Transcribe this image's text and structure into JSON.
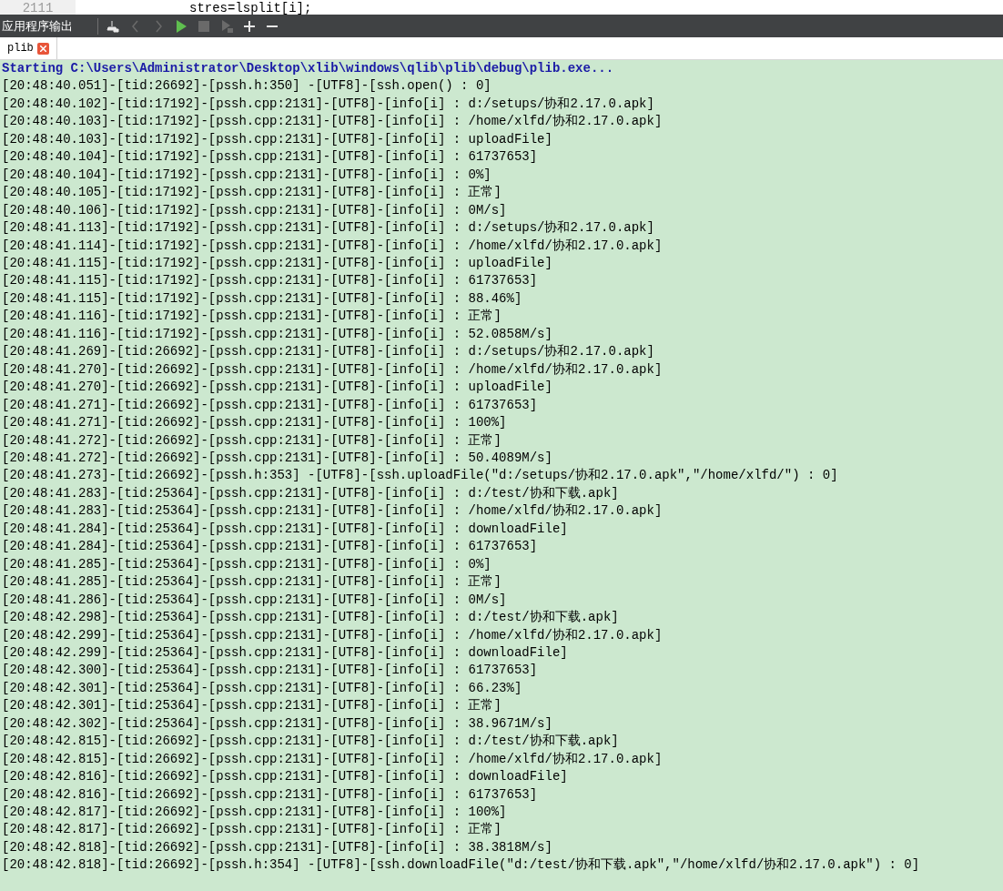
{
  "editor_line": {
    "number": "2111",
    "code": "stres=lsplit[i];"
  },
  "panel": {
    "title": "应用程序输出",
    "toolbar": [
      {
        "kind": "clear",
        "disabled": false
      },
      {
        "kind": "prev",
        "disabled": true
      },
      {
        "kind": "next",
        "disabled": true
      },
      {
        "kind": "run",
        "disabled": false
      },
      {
        "kind": "stop",
        "disabled": true
      },
      {
        "kind": "debug",
        "disabled": true
      },
      {
        "kind": "zoom_in",
        "disabled": false
      },
      {
        "kind": "zoom_out",
        "disabled": false
      }
    ]
  },
  "tabs": [
    {
      "label": "plib",
      "selected": true
    }
  ],
  "output": {
    "header": "Starting C:\\Users\\Administrator\\Desktop\\xlib\\windows\\qlib\\plib\\debug\\plib.exe...",
    "lines": [
      "[20:48:40.051]-[tid:26692]-[pssh.h:350] -[UTF8]-[ssh.open() : 0]",
      "[20:48:40.102]-[tid:17192]-[pssh.cpp:2131]-[UTF8]-[info[i] : d:/setups/协和2.17.0.apk]",
      "[20:48:40.103]-[tid:17192]-[pssh.cpp:2131]-[UTF8]-[info[i] : /home/xlfd/协和2.17.0.apk]",
      "[20:48:40.103]-[tid:17192]-[pssh.cpp:2131]-[UTF8]-[info[i] : uploadFile]",
      "[20:48:40.104]-[tid:17192]-[pssh.cpp:2131]-[UTF8]-[info[i] : 61737653]",
      "[20:48:40.104]-[tid:17192]-[pssh.cpp:2131]-[UTF8]-[info[i] : 0%]",
      "[20:48:40.105]-[tid:17192]-[pssh.cpp:2131]-[UTF8]-[info[i] : 正常]",
      "[20:48:40.106]-[tid:17192]-[pssh.cpp:2131]-[UTF8]-[info[i] : 0M/s]",
      "[20:48:41.113]-[tid:17192]-[pssh.cpp:2131]-[UTF8]-[info[i] : d:/setups/协和2.17.0.apk]",
      "[20:48:41.114]-[tid:17192]-[pssh.cpp:2131]-[UTF8]-[info[i] : /home/xlfd/协和2.17.0.apk]",
      "[20:48:41.115]-[tid:17192]-[pssh.cpp:2131]-[UTF8]-[info[i] : uploadFile]",
      "[20:48:41.115]-[tid:17192]-[pssh.cpp:2131]-[UTF8]-[info[i] : 61737653]",
      "[20:48:41.115]-[tid:17192]-[pssh.cpp:2131]-[UTF8]-[info[i] : 88.46%]",
      "[20:48:41.116]-[tid:17192]-[pssh.cpp:2131]-[UTF8]-[info[i] : 正常]",
      "[20:48:41.116]-[tid:17192]-[pssh.cpp:2131]-[UTF8]-[info[i] : 52.0858M/s]",
      "[20:48:41.269]-[tid:26692]-[pssh.cpp:2131]-[UTF8]-[info[i] : d:/setups/协和2.17.0.apk]",
      "[20:48:41.270]-[tid:26692]-[pssh.cpp:2131]-[UTF8]-[info[i] : /home/xlfd/协和2.17.0.apk]",
      "[20:48:41.270]-[tid:26692]-[pssh.cpp:2131]-[UTF8]-[info[i] : uploadFile]",
      "[20:48:41.271]-[tid:26692]-[pssh.cpp:2131]-[UTF8]-[info[i] : 61737653]",
      "[20:48:41.271]-[tid:26692]-[pssh.cpp:2131]-[UTF8]-[info[i] : 100%]",
      "[20:48:41.272]-[tid:26692]-[pssh.cpp:2131]-[UTF8]-[info[i] : 正常]",
      "[20:48:41.272]-[tid:26692]-[pssh.cpp:2131]-[UTF8]-[info[i] : 50.4089M/s]",
      "[20:48:41.273]-[tid:26692]-[pssh.h:353] -[UTF8]-[ssh.uploadFile(\"d:/setups/协和2.17.0.apk\",\"/home/xlfd/\") : 0]",
      "[20:48:41.283]-[tid:25364]-[pssh.cpp:2131]-[UTF8]-[info[i] : d:/test/协和下载.apk]",
      "[20:48:41.283]-[tid:25364]-[pssh.cpp:2131]-[UTF8]-[info[i] : /home/xlfd/协和2.17.0.apk]",
      "[20:48:41.284]-[tid:25364]-[pssh.cpp:2131]-[UTF8]-[info[i] : downloadFile]",
      "[20:48:41.284]-[tid:25364]-[pssh.cpp:2131]-[UTF8]-[info[i] : 61737653]",
      "[20:48:41.285]-[tid:25364]-[pssh.cpp:2131]-[UTF8]-[info[i] : 0%]",
      "[20:48:41.285]-[tid:25364]-[pssh.cpp:2131]-[UTF8]-[info[i] : 正常]",
      "[20:48:41.286]-[tid:25364]-[pssh.cpp:2131]-[UTF8]-[info[i] : 0M/s]",
      "[20:48:42.298]-[tid:25364]-[pssh.cpp:2131]-[UTF8]-[info[i] : d:/test/协和下载.apk]",
      "[20:48:42.299]-[tid:25364]-[pssh.cpp:2131]-[UTF8]-[info[i] : /home/xlfd/协和2.17.0.apk]",
      "[20:48:42.299]-[tid:25364]-[pssh.cpp:2131]-[UTF8]-[info[i] : downloadFile]",
      "[20:48:42.300]-[tid:25364]-[pssh.cpp:2131]-[UTF8]-[info[i] : 61737653]",
      "[20:48:42.301]-[tid:25364]-[pssh.cpp:2131]-[UTF8]-[info[i] : 66.23%]",
      "[20:48:42.301]-[tid:25364]-[pssh.cpp:2131]-[UTF8]-[info[i] : 正常]",
      "[20:48:42.302]-[tid:25364]-[pssh.cpp:2131]-[UTF8]-[info[i] : 38.9671M/s]",
      "[20:48:42.815]-[tid:26692]-[pssh.cpp:2131]-[UTF8]-[info[i] : d:/test/协和下载.apk]",
      "[20:48:42.815]-[tid:26692]-[pssh.cpp:2131]-[UTF8]-[info[i] : /home/xlfd/协和2.17.0.apk]",
      "[20:48:42.816]-[tid:26692]-[pssh.cpp:2131]-[UTF8]-[info[i] : downloadFile]",
      "[20:48:42.816]-[tid:26692]-[pssh.cpp:2131]-[UTF8]-[info[i] : 61737653]",
      "[20:48:42.817]-[tid:26692]-[pssh.cpp:2131]-[UTF8]-[info[i] : 100%]",
      "[20:48:42.817]-[tid:26692]-[pssh.cpp:2131]-[UTF8]-[info[i] : 正常]",
      "[20:48:42.818]-[tid:26692]-[pssh.cpp:2131]-[UTF8]-[info[i] : 38.3818M/s]",
      "[20:48:42.818]-[tid:26692]-[pssh.h:354] -[UTF8]-[ssh.downloadFile(\"d:/test/协和下载.apk\",\"/home/xlfd/协和2.17.0.apk\") : 0]"
    ]
  }
}
